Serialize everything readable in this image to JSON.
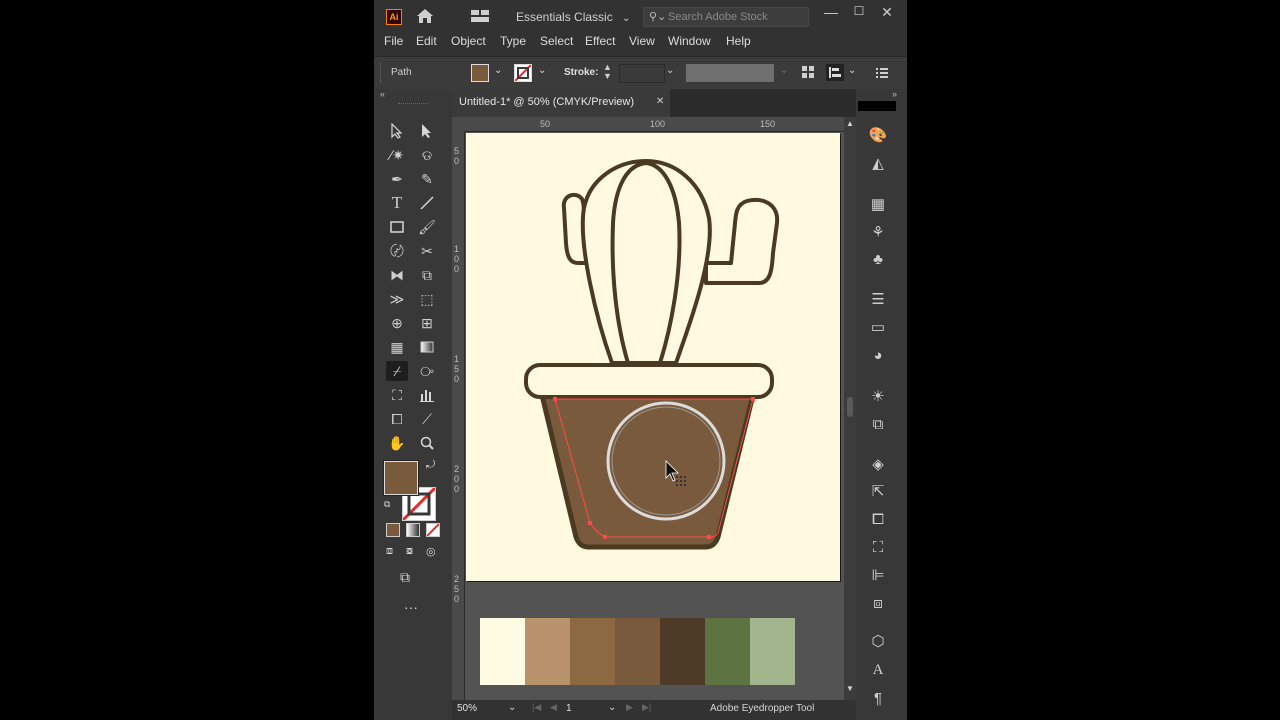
{
  "window": {
    "app_icon": "Ai",
    "workspace": "Essentials Classic",
    "search_placeholder": "Search Adobe Stock",
    "minimize": "—",
    "maximize": "☐",
    "close": "✕"
  },
  "menu": [
    "File",
    "Edit",
    "Object",
    "Type",
    "Select",
    "Effect",
    "View",
    "Window",
    "Help"
  ],
  "control_bar": {
    "selection_type": "Path",
    "fill_color": "#7a5a3c",
    "stroke_label": "Stroke:"
  },
  "document": {
    "tab_title": "Untitled-1* @ 50% (CMYK/Preview)",
    "tab_close": "✕",
    "ruler_top": [
      "50",
      "100",
      "150"
    ],
    "ruler_left": [
      "5\n0",
      "1\n0\n0",
      "1\n5\n0",
      "2\n0\n0",
      "2\n5\n0"
    ],
    "artboard_color": "#fffadf",
    "swatches": [
      "#fffbe2",
      "#b8926a",
      "#8c6940",
      "#7a5a3c",
      "#4d3b27",
      "#5d7342",
      "#a3b58d"
    ]
  },
  "status": {
    "zoom": "50%",
    "artboard_num": "1",
    "tool_name": "Adobe Eyedropper Tool"
  },
  "colors": {
    "cactus_stroke": "#4a3a22",
    "pot_fill": "#7a5a3c",
    "path_highlight": "#ff4a4a"
  }
}
